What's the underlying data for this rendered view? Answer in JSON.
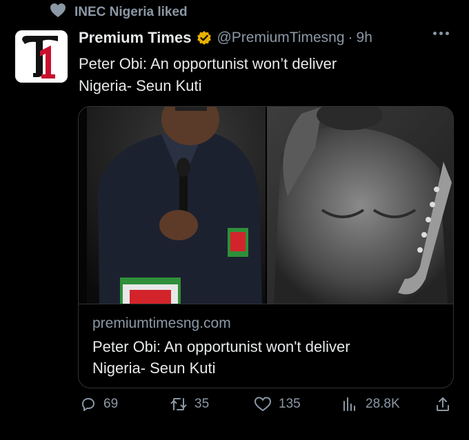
{
  "social_context": {
    "icon": "heart-filled-icon",
    "text": "INEC Nigeria liked"
  },
  "tweet": {
    "author": {
      "name": "Premium Times",
      "handle": "@PremiumTimesng",
      "time": "9h",
      "separator": "·",
      "verified_icon": "verified-badge-icon",
      "avatar_icon": "premium-times-logo"
    },
    "text": "Peter Obi: An opportunist won’t deliver\nNigeria- Seun Kuti",
    "link_card": {
      "domain": "premiumtimesng.com",
      "title": "Peter Obi: An opportunist won't deliver\nNigeria- Seun Kuti",
      "images": [
        "photo-peter-obi-speaking",
        "photo-seun-kuti-saxophone"
      ]
    },
    "actions": {
      "replies": "69",
      "retweets": "35",
      "likes": "135",
      "views": "28.8K"
    }
  },
  "colors": {
    "background": "#000000",
    "text": "#e7e9ea",
    "muted": "#8b98a5",
    "border": "#2f3336",
    "verified": "#e8b100",
    "logo_red": "#c8102e"
  }
}
